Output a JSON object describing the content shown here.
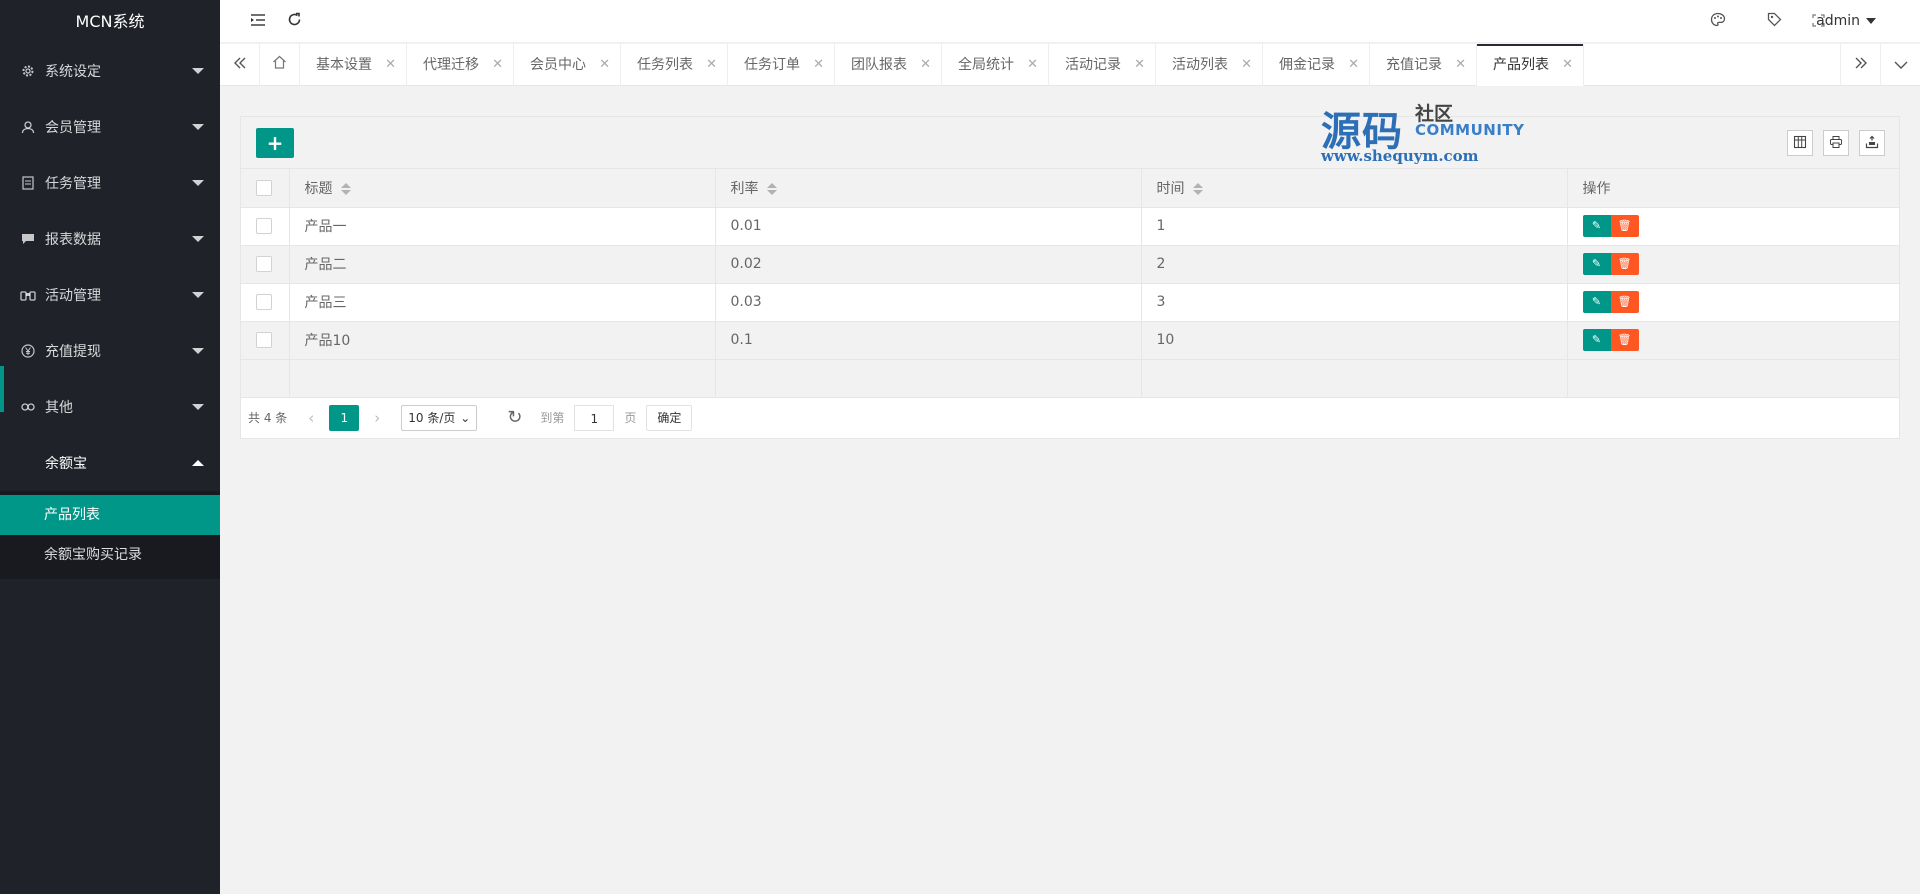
{
  "app": {
    "title": "MCN系统"
  },
  "sidebar": {
    "items": [
      {
        "label": "系统设定",
        "icon": "gear-icon"
      },
      {
        "label": "会员管理",
        "icon": "user-icon"
      },
      {
        "label": "任务管理",
        "icon": "document-icon"
      },
      {
        "label": "报表数据",
        "icon": "chat-icon"
      },
      {
        "label": "活动管理",
        "icon": "binoculars-icon"
      },
      {
        "label": "充值提现",
        "icon": "yen-icon"
      },
      {
        "label": "其他",
        "icon": "link-icon"
      },
      {
        "label": "余额宝",
        "icon": ""
      }
    ],
    "submenu": [
      {
        "label": "产品列表"
      },
      {
        "label": "余额宝购买记录"
      }
    ]
  },
  "header": {
    "user": "admin"
  },
  "tabs": [
    {
      "label": "基本设置"
    },
    {
      "label": "代理迁移"
    },
    {
      "label": "会员中心"
    },
    {
      "label": "任务列表"
    },
    {
      "label": "任务订单"
    },
    {
      "label": "团队报表"
    },
    {
      "label": "全局统计"
    },
    {
      "label": "活动记录"
    },
    {
      "label": "活动列表"
    },
    {
      "label": "佣金记录"
    },
    {
      "label": "充值记录"
    },
    {
      "label": "产品列表"
    }
  ],
  "watermark": {
    "cn": "源码",
    "cn2": "社区",
    "en": "COMMUNITY",
    "url": "www.shequym.com"
  },
  "table": {
    "columns": [
      "标题",
      "利率",
      "时间",
      "操作"
    ],
    "rows": [
      {
        "title": "产品一",
        "rate": "0.01",
        "time": "1"
      },
      {
        "title": "产品二",
        "rate": "0.02",
        "time": "2"
      },
      {
        "title": "产品三",
        "rate": "0.03",
        "time": "3"
      },
      {
        "title": "产品10",
        "rate": "0.1",
        "time": "10"
      }
    ]
  },
  "pager": {
    "total": "共 4 条",
    "current": "1",
    "limit": "10 条/页",
    "goto_label": "到第",
    "goto_value": "1",
    "page_label": "页",
    "confirm": "确定"
  },
  "colors": {
    "primary": "#009688",
    "danger": "#ff5722",
    "sidebar": "#20222a"
  }
}
